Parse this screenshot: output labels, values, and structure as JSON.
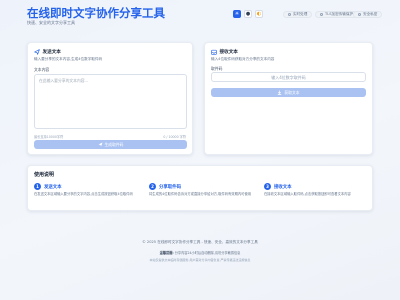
{
  "header": {
    "title": "在线即时文字协作分享工具",
    "subtitle": "快速、安全的文字分享工具"
  },
  "theme_buttons": [
    {
      "name": "light",
      "icon": "sun-icon",
      "glyph": "☀"
    },
    {
      "name": "dark",
      "icon": "moon-icon",
      "glyph": "●"
    },
    {
      "name": "auto",
      "icon": "auto-theme-icon",
      "glyph": "◐"
    }
  ],
  "status": {
    "realtime_label": "实时处理",
    "cleanup_label": "TLS加密传输保护",
    "privacy_label": "安全私密"
  },
  "send_card": {
    "title": "发送文本",
    "description": "输入要分享的文本内容,生成4位数字取件码",
    "field_label": "文本内容",
    "placeholder": "在此输入要分享的文本内容...",
    "hint": "最长支持10000字符",
    "counter": "0 / 10000 字符",
    "button_label": "生成取件码"
  },
  "receive_card": {
    "title": "接收文本",
    "description": "输入4位取件码获取对方分享的文本内容",
    "field_label": "取件码",
    "placeholder": "输入4位数字取件码",
    "button_label": "获取文本"
  },
  "guide": {
    "title": "使用说明",
    "steps": [
      {
        "num": "1",
        "title": "发送文本",
        "desc": "在发送文本区域输入要分享的文字内容,点击生成按钮获取4位取件码"
      },
      {
        "num": "2",
        "title": "分享取件码",
        "desc": "将生成的4位取件码告诉对方或直接分享给对方,取件码有效期内可使用"
      },
      {
        "num": "3",
        "title": "接收文本",
        "desc": "在接收文本区域输入取件码,点击获取按钮即可查看文本内容"
      }
    ]
  },
  "footer": {
    "copyright": "© 2025 在线即时文字协作分享工具 - 快速、安全、高效的文本分享工具",
    "notice_label": "温馨提醒:",
    "notice_text": "分享内容24小时后自动删除,请勿分享敏感信息",
    "disclaimer": "本站仅提供文本临时存储服务,用户需对分享内容负责,严禁传播违法违规信息"
  }
}
